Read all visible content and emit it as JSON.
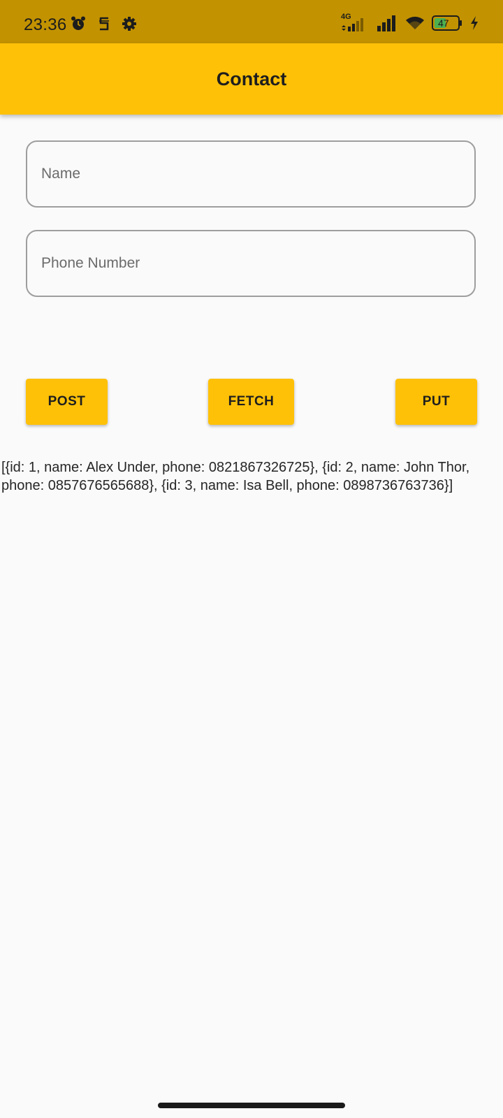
{
  "status_bar": {
    "time": "23:36",
    "network_type": "4G",
    "battery_level": "47",
    "icons": [
      "alarm-icon",
      "s-notification-icon",
      "settings-gear-icon",
      "signal-4g-icon",
      "signal-icon",
      "wifi-icon",
      "battery-icon",
      "charging-bolt-icon"
    ],
    "color": "#c29200"
  },
  "app_bar": {
    "title": "Contact",
    "color": "#ffc107"
  },
  "form": {
    "name_field": {
      "placeholder": "Name",
      "value": ""
    },
    "phone_field": {
      "placeholder": "Phone Number",
      "value": ""
    }
  },
  "buttons": {
    "post_label": "POST",
    "fetch_label": "FETCH",
    "put_label": "PUT",
    "color": "#ffc107"
  },
  "result": {
    "text": "[{id: 1, name: Alex Under, phone: 0821867326725}, {id: 2, name: John Thor, phone: 0857676565688}, {id: 3, name: Isa Bell, phone: 0898736763736}]"
  }
}
